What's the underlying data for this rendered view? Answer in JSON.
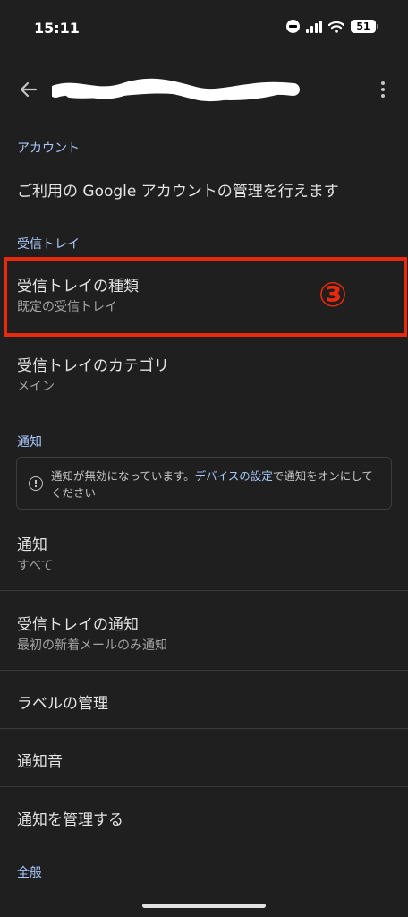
{
  "status_bar": {
    "time": "15:11",
    "battery": "51"
  },
  "sections": {
    "account": {
      "header": "アカウント",
      "manage": "ご利用の Google アカウントの管理を行えます"
    },
    "inbox": {
      "header": "受信トレイ",
      "type_title": "受信トレイの種類",
      "type_value": "既定の受信トレイ",
      "category_title": "受信トレイのカテゴリ",
      "category_value": "メイン"
    },
    "notification": {
      "header": "通知",
      "notice_before": "通知が無効になっています。",
      "notice_link": "デバイスの設定",
      "notice_after": "で通知をオンにしてください",
      "notify_title": "通知",
      "notify_value": "すべて",
      "inbox_notify_title": "受信トレイの通知",
      "inbox_notify_value": "最初の新着メールのみ通知",
      "manage_labels": "ラベルの管理",
      "sound": "通知音",
      "manage_notifications": "通知を管理する"
    },
    "general": {
      "header": "全般"
    }
  },
  "annotation": {
    "number": "③",
    "color": "#e8290e"
  },
  "colors": {
    "background": "#1f1f1f",
    "accent": "#a8c7fa"
  }
}
